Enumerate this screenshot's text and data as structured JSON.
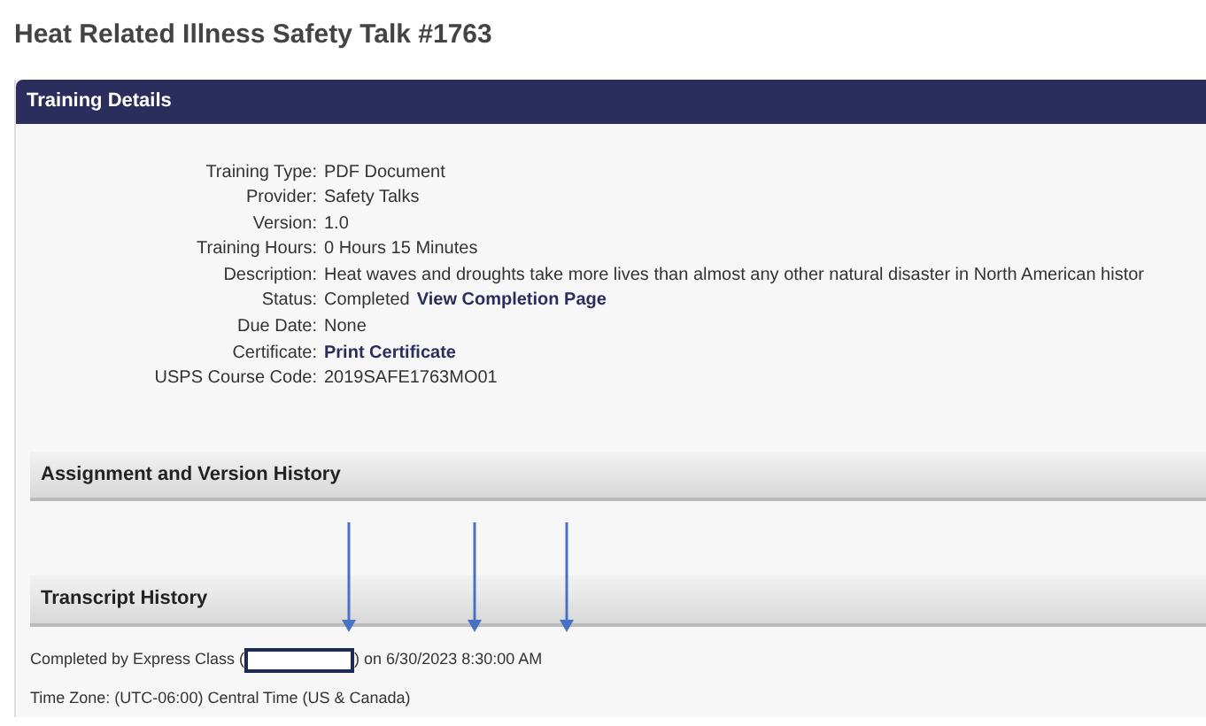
{
  "page_title": "Heat Related Illness Safety Talk #1763",
  "panel": {
    "title": "Training Details",
    "details": [
      {
        "label": "Training Type:",
        "value": "PDF Document"
      },
      {
        "label": "Provider:",
        "value": "Safety Talks"
      },
      {
        "label": "Version:",
        "value": "1.0"
      },
      {
        "label": "Training Hours:",
        "value": "0 Hours 15 Minutes"
      },
      {
        "label": "Description:",
        "value": "Heat waves and droughts take more lives than almost any other natural disaster in North American histor"
      },
      {
        "label": "Status:",
        "value": "Completed",
        "link": "View Completion Page"
      },
      {
        "label": "Due Date:",
        "value": "None"
      },
      {
        "label": "Certificate:",
        "link": "Print Certificate"
      },
      {
        "label": "USPS Course Code:",
        "value": "2019SAFE1763MO01"
      }
    ],
    "sections": [
      "Assignment and Version History",
      "Transcript History"
    ],
    "transcript": {
      "before": "Completed by Express Class (",
      "after": ") on 6/30/2023 8:30:00 AM",
      "time_zone": "Time Zone: (UTC-06:00) Central Time (US & Canada)"
    }
  }
}
